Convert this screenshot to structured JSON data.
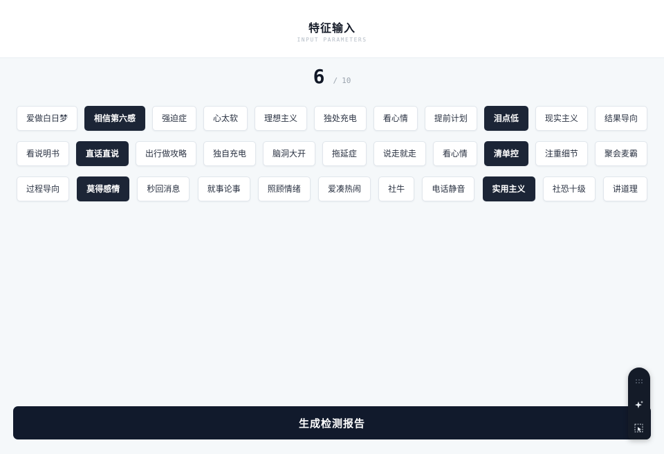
{
  "header": {
    "title": "特征输入",
    "subtitle": "INPUT PARAMETERS"
  },
  "counter": {
    "current": "6",
    "separator": "/",
    "total": "10"
  },
  "tag_rows": [
    [
      {
        "label": "爱做白日梦",
        "selected": false
      },
      {
        "label": "相信第六感",
        "selected": true
      },
      {
        "label": "强迫症",
        "selected": false
      },
      {
        "label": "心太软",
        "selected": false
      },
      {
        "label": "理想主义",
        "selected": false
      },
      {
        "label": "独处充电",
        "selected": false
      },
      {
        "label": "看心情",
        "selected": false
      },
      {
        "label": "提前计划",
        "selected": false
      },
      {
        "label": "泪点低",
        "selected": true
      },
      {
        "label": "现实主义",
        "selected": false
      },
      {
        "label": "结果导向",
        "selected": false
      }
    ],
    [
      {
        "label": "看说明书",
        "selected": false
      },
      {
        "label": "直话直说",
        "selected": true
      },
      {
        "label": "出行做攻略",
        "selected": false
      },
      {
        "label": "独自充电",
        "selected": false
      },
      {
        "label": "脑洞大开",
        "selected": false
      },
      {
        "label": "拖延症",
        "selected": false
      },
      {
        "label": "说走就走",
        "selected": false
      },
      {
        "label": "看心情",
        "selected": false
      },
      {
        "label": "清单控",
        "selected": true
      },
      {
        "label": "注重细节",
        "selected": false
      },
      {
        "label": "聚会麦霸",
        "selected": false
      }
    ],
    [
      {
        "label": "过程导向",
        "selected": false
      },
      {
        "label": "莫得感情",
        "selected": true
      },
      {
        "label": "秒回消息",
        "selected": false
      },
      {
        "label": "就事论事",
        "selected": false
      },
      {
        "label": "照顾情绪",
        "selected": false
      },
      {
        "label": "爱凑热闹",
        "selected": false
      },
      {
        "label": "社牛",
        "selected": false
      },
      {
        "label": "电话静音",
        "selected": false
      },
      {
        "label": "实用主义",
        "selected": true
      },
      {
        "label": "社恐十级",
        "selected": false
      },
      {
        "label": "讲道理",
        "selected": false
      }
    ]
  ],
  "actions": {
    "generate_label": "生成检测报告"
  },
  "toolbar": {
    "icons": [
      "grid-dots-icon",
      "sparkle-icon",
      "select-cursor-icon"
    ]
  },
  "colors": {
    "selected_tag": "#1c2536",
    "primary_button": "#111a2c",
    "background": "#f5f8fa"
  }
}
